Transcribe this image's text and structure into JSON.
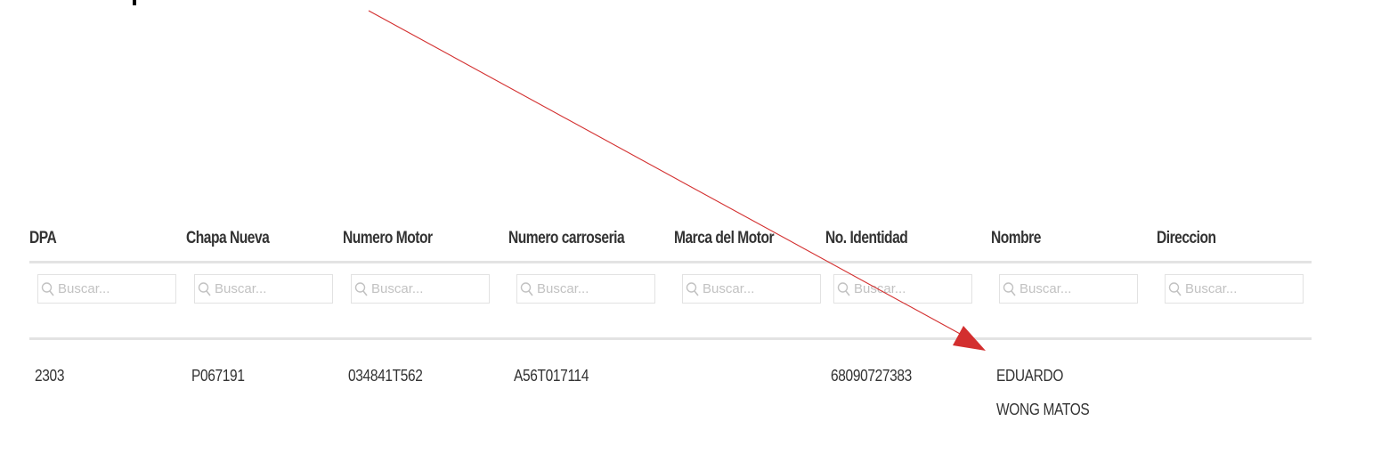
{
  "table": {
    "columns": [
      "DPA",
      "Chapa Nueva",
      "Numero Motor",
      "Numero carroseria",
      "Marca del Motor",
      "No. Identidad",
      "Nombre",
      "Direccion"
    ],
    "search_placeholder": "Buscar...",
    "rows": [
      [
        "2303",
        "P067191",
        "034841T562",
        "A56T017114",
        "",
        "68090727383",
        "EDUARDO WONG MATOS",
        ""
      ]
    ]
  },
  "annotation": {
    "arrow_color": "#d32f2f",
    "icon": "red-arrow-icon"
  }
}
